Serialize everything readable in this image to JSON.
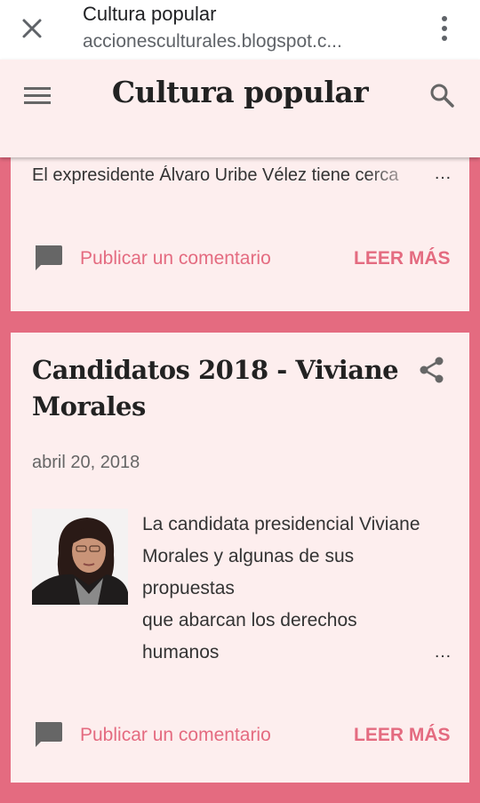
{
  "browser": {
    "title": "Cultura popular",
    "url": "accionesculturales.blogspot.c..."
  },
  "header": {
    "site_title": "Cultura popular"
  },
  "previous_post": {
    "excerpt": "El expresidente Álvaro Uribe Vélez tiene cerca",
    "ellipsis": "…",
    "comment_label": "Publicar un comentario",
    "read_more": "LEER MÁS"
  },
  "post": {
    "title": "Candidatos 2018 - Viviane Morales",
    "date": "abril 20, 2018",
    "excerpt_lines": [
      "La candidata presidencial Viviane",
      "Morales y algunas de sus",
      "propuestas",
      "que abarcan los derechos",
      "humanos"
    ],
    "ellipsis": "…",
    "comment_label": "Publicar un comentario",
    "read_more": "LEER MÁS"
  },
  "icons": {
    "close": "close-icon",
    "menu": "more-vert-icon",
    "hamburger": "hamburger-menu-icon",
    "search": "search-icon",
    "share": "share-icon",
    "comment": "comment-icon"
  },
  "colors": {
    "background": "#e46b80",
    "card": "#fdeeee",
    "accent": "#e46b80",
    "text": "#333333"
  }
}
